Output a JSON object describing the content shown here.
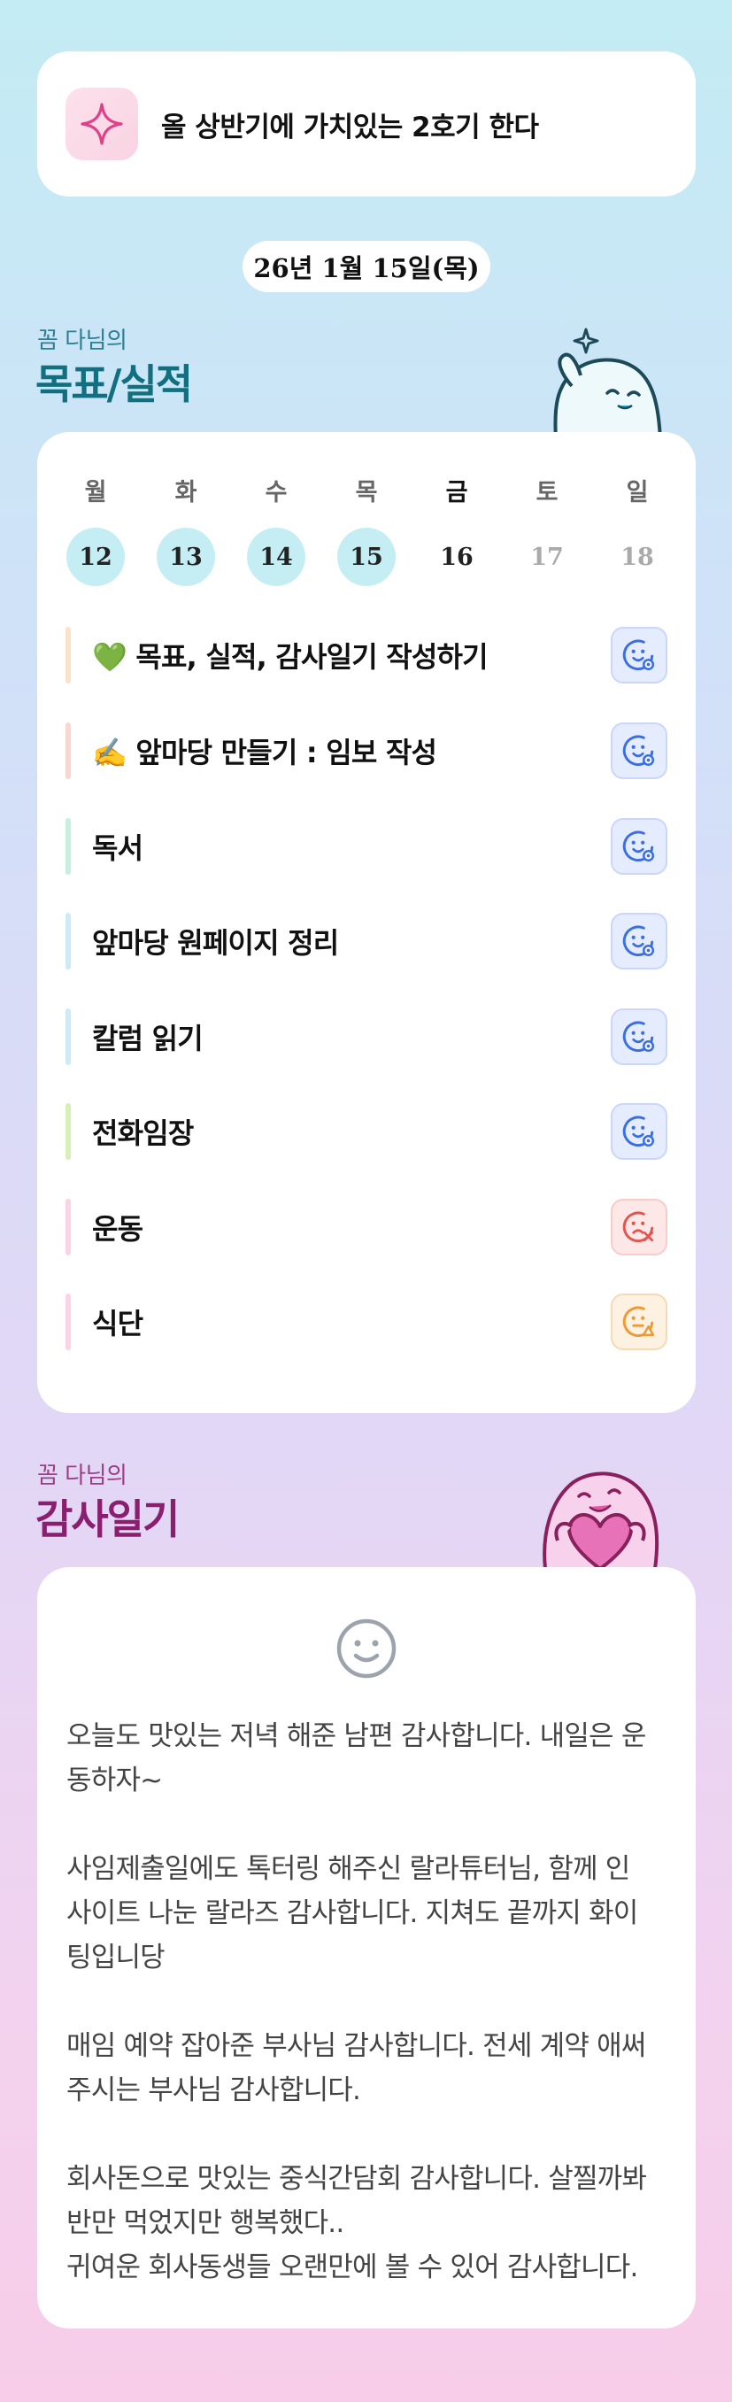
{
  "motto": {
    "text": "올 상반기에 가치있는 2호기 한다",
    "icon": "sparkle-icon"
  },
  "date": "26년 1월 15일(목)",
  "goals_section": {
    "subtitle": "꼼 다님의",
    "title": "목표/실적"
  },
  "week": [
    {
      "day": "월",
      "date": "12",
      "state": "done"
    },
    {
      "day": "화",
      "date": "13",
      "state": "done"
    },
    {
      "day": "수",
      "date": "14",
      "state": "done"
    },
    {
      "day": "목",
      "date": "15",
      "state": "done"
    },
    {
      "day": "금",
      "date": "16",
      "state": "today"
    },
    {
      "day": "토",
      "date": "17",
      "state": "future"
    },
    {
      "day": "일",
      "date": "18",
      "state": "future"
    }
  ],
  "goals": [
    {
      "label": "💚 목표, 실적, 감사일기 작성하기",
      "bar_color": "#fbe3c7",
      "status": "ok"
    },
    {
      "label": "✍️ 앞마당 만들기 : 임보 작성",
      "bar_color": "#fbd6cf",
      "status": "ok"
    },
    {
      "label": "독서",
      "bar_color": "#c6efe0",
      "status": "ok"
    },
    {
      "label": "앞마당 원페이지 정리",
      "bar_color": "#cdebf5",
      "status": "ok"
    },
    {
      "label": "칼럼 읽기",
      "bar_color": "#cdebf5",
      "status": "ok"
    },
    {
      "label": "전화임장",
      "bar_color": "#d7f0b8",
      "status": "ok"
    },
    {
      "label": "운동",
      "bar_color": "#fbd2e6",
      "status": "fail"
    },
    {
      "label": "식단",
      "bar_color": "#fbd2e6",
      "status": "warn"
    }
  ],
  "status_colors": {
    "ok": "#3b6fe0",
    "fail": "#e2564f",
    "warn": "#ee9a34"
  },
  "gratitude_section": {
    "subtitle": "꼼 다님의",
    "title": "감사일기"
  },
  "gratitude": {
    "icon": "smile-icon",
    "text": "오늘도 맛있는 저녁 해준 남편 감사합니다. 내일은 운\n동하자~\n\n사임제출일에도 톡터링 해주신 랄라튜터님, 함께 인\n사이트 나눈 랄라즈 감사합니다. 지쳐도 끝까지 화이\n팅입니당\n\n매임 예약 잡아준 부사님 감사합니다. 전세 계약 애써\n주시는 부사님 감사합니다.\n\n회사돈으로 맛있는 중식간담회 감사합니다. 살찔까봐\n반만 먹었지만 행복했다..\n귀여운 회사동생들 오랜만에 볼 수 있어 감사합니다."
  }
}
